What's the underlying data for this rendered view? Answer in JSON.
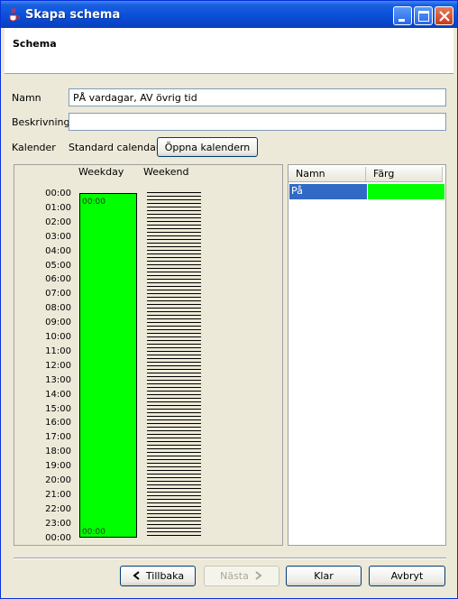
{
  "window": {
    "title": "Skapa schema"
  },
  "header": {
    "title": "Schema"
  },
  "form": {
    "name_label": "Namn",
    "name_value": "PÅ vardagar, AV övrig tid",
    "description_label": "Beskrivning",
    "description_value": "",
    "calendar_label": "Kalender",
    "calendar_value": "Standard calendar",
    "open_calendar_button": "Öppna kalendern"
  },
  "schedule": {
    "columns": [
      "Weekday",
      "Weekend"
    ],
    "times": [
      "00:00",
      "01:00",
      "02:00",
      "03:00",
      "04:00",
      "05:00",
      "06:00",
      "07:00",
      "08:00",
      "09:00",
      "10:00",
      "11:00",
      "12:00",
      "13:00",
      "14:00",
      "15:00",
      "16:00",
      "17:00",
      "18:00",
      "19:00",
      "20:00",
      "21:00",
      "22:00",
      "23:00",
      "00:00"
    ],
    "weekday_block": {
      "state": "På",
      "start": "00:00",
      "end": "00:00",
      "color": "#00ff00"
    }
  },
  "states_table": {
    "headers": [
      "Namn",
      "Färg"
    ],
    "rows": [
      {
        "name": "På",
        "color": "#00ff00"
      }
    ],
    "selected_color": "#316ac5"
  },
  "buttons": {
    "back": "Tillbaka",
    "next": "Nästa",
    "finish": "Klar",
    "cancel": "Avbryt"
  }
}
